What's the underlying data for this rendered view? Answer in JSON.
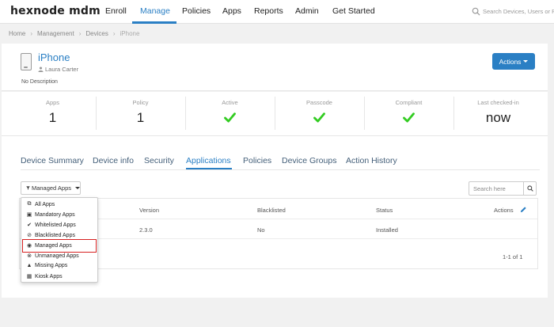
{
  "app": {
    "logo": "hexnode mdm",
    "nav": [
      "Enroll",
      "Manage",
      "Policies",
      "Apps",
      "Reports",
      "Admin",
      "Get Started"
    ],
    "active_nav": "Manage",
    "search_placeholder": "Search Devices, Users or Po"
  },
  "breadcrumb": [
    "Home",
    "Management",
    "Devices",
    "iPhone"
  ],
  "device": {
    "name": "iPhone",
    "user": "Laura Carter",
    "description": "No Description",
    "actions_label": "Actions"
  },
  "stats": [
    {
      "label": "Apps",
      "value": "1"
    },
    {
      "label": "Policy",
      "value": "1"
    },
    {
      "label": "Active",
      "icon": "check-icon"
    },
    {
      "label": "Passcode",
      "icon": "check-icon"
    },
    {
      "label": "Compliant",
      "icon": "check-icon"
    },
    {
      "label": "Last checked-in",
      "value": "now"
    }
  ],
  "tabs": [
    "Device Summary",
    "Device info",
    "Security",
    "Applications",
    "Policies",
    "Device Groups",
    "Action History"
  ],
  "active_tab": "Applications",
  "filter": {
    "label": "Managed Apps",
    "options": [
      "All Apps",
      "Mandatory Apps",
      "Whitelisted Apps",
      "Blacklisted Apps",
      "Managed Apps",
      "Unmanaged Apps",
      "Missing Apps",
      "Kiosk Apps"
    ],
    "highlighted": "Managed Apps"
  },
  "table_search_placeholder": "Search here",
  "table": {
    "columns": [
      "Version",
      "Blacklisted",
      "Status",
      "Actions"
    ],
    "rows": [
      {
        "version": "2.3.0",
        "blacklisted": "No",
        "status": "Installed"
      }
    ]
  },
  "pager": "1-1 of 1",
  "colors": {
    "accent": "#2a7fc4",
    "check": "#33cc22",
    "highlight": "#d62020"
  }
}
